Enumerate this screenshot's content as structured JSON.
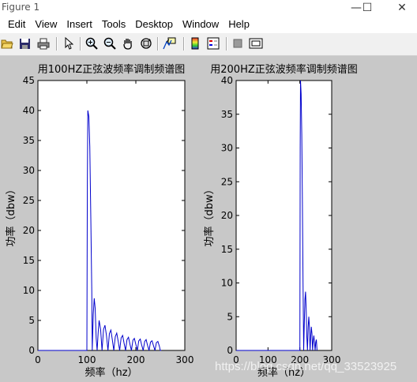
{
  "window": {
    "title": "Figure 1",
    "minimize_glyph": "—",
    "maximize_glyph": "☐",
    "close_glyph": "✕"
  },
  "menu": [
    "Edit",
    "View",
    "Insert",
    "Tools",
    "Desktop",
    "Window",
    "Help"
  ],
  "toolbar_icons": [
    "open-folder-icon",
    "save-icon",
    "print-icon",
    "pointer-icon",
    "zoom-in-icon",
    "zoom-out-icon",
    "pan-hand-icon",
    "rotate-3d-icon",
    "data-cursor-icon",
    "colorbar-icon",
    "legend-icon",
    "hide-plot-tools-icon",
    "show-plot-tools-icon"
  ],
  "colors": {
    "line": "#0000cc",
    "figure_bg": "#c8c8c8",
    "axes_bg": "#ffffff"
  },
  "watermark": "https://blog.csdn.net/qq_33523925",
  "chart_data": [
    {
      "type": "line",
      "title": "用100HZ正弦波频率调制频谱图",
      "xlabel": "频率（hz）",
      "ylabel": "功率（dbw）",
      "xlim": [
        0,
        300
      ],
      "ylim": [
        0,
        45
      ],
      "xticks": [
        0,
        100,
        200,
        300
      ],
      "yticks": [
        0,
        5,
        10,
        15,
        20,
        25,
        30,
        35,
        40,
        45
      ],
      "grid": false,
      "series": [
        {
          "x": [
            0,
            100,
            101,
            102,
            104,
            106,
            108,
            110,
            111,
            113,
            115,
            117,
            119,
            121,
            123,
            125,
            128,
            131,
            134,
            137,
            140,
            143,
            146,
            149,
            152,
            155,
            158,
            161,
            164,
            167,
            170,
            173,
            176,
            179,
            182,
            185,
            188,
            191,
            194,
            197,
            200,
            203,
            206,
            209,
            212,
            215,
            218,
            221,
            224,
            227,
            230,
            233,
            236,
            239,
            242,
            245,
            248,
            250,
            252
          ],
          "y": [
            0,
            0,
            28,
            40,
            39,
            34,
            22,
            10,
            0,
            6,
            8.7,
            7,
            2,
            0,
            3,
            5,
            3.5,
            0,
            3.5,
            4.2,
            2.5,
            0,
            2.8,
            3.4,
            1.8,
            0,
            2.3,
            2.9,
            1.5,
            0,
            2.1,
            2.5,
            1.2,
            0,
            1.8,
            2.2,
            1.0,
            0,
            1.7,
            2.0,
            1.0,
            0,
            1.6,
            1.9,
            0.9,
            0,
            1.5,
            1.8,
            0.8,
            0,
            1.4,
            1.6,
            0.8,
            0,
            1.3,
            1.5,
            0.7,
            0,
            0
          ]
        }
      ]
    },
    {
      "type": "line",
      "title": "用200HZ正弦波频率调制频谱图",
      "xlabel": "频率（hz）",
      "ylabel": "功率（dbw）",
      "xlim": [
        0,
        300
      ],
      "ylim": [
        0,
        40
      ],
      "xticks": [
        0,
        100,
        200,
        300
      ],
      "yticks": [
        0,
        5,
        10,
        15,
        20,
        25,
        30,
        35,
        40
      ],
      "grid": false,
      "series": [
        {
          "x": [
            0,
            200,
            201,
            202,
            204,
            206,
            208,
            210,
            212,
            214,
            216,
            218,
            220,
            222,
            224,
            226,
            228,
            230,
            232,
            234,
            236,
            238,
            240,
            242,
            244,
            246,
            248,
            250,
            252,
            254
          ],
          "y": [
            0,
            0,
            30,
            40,
            38,
            32,
            22,
            10,
            0,
            4,
            7.5,
            8.7,
            6,
            2,
            0,
            3.5,
            5,
            3.5,
            0,
            2,
            3.5,
            2.5,
            0,
            1.5,
            2.2,
            1.2,
            0,
            1.2,
            1.6,
            0
          ]
        }
      ]
    }
  ]
}
